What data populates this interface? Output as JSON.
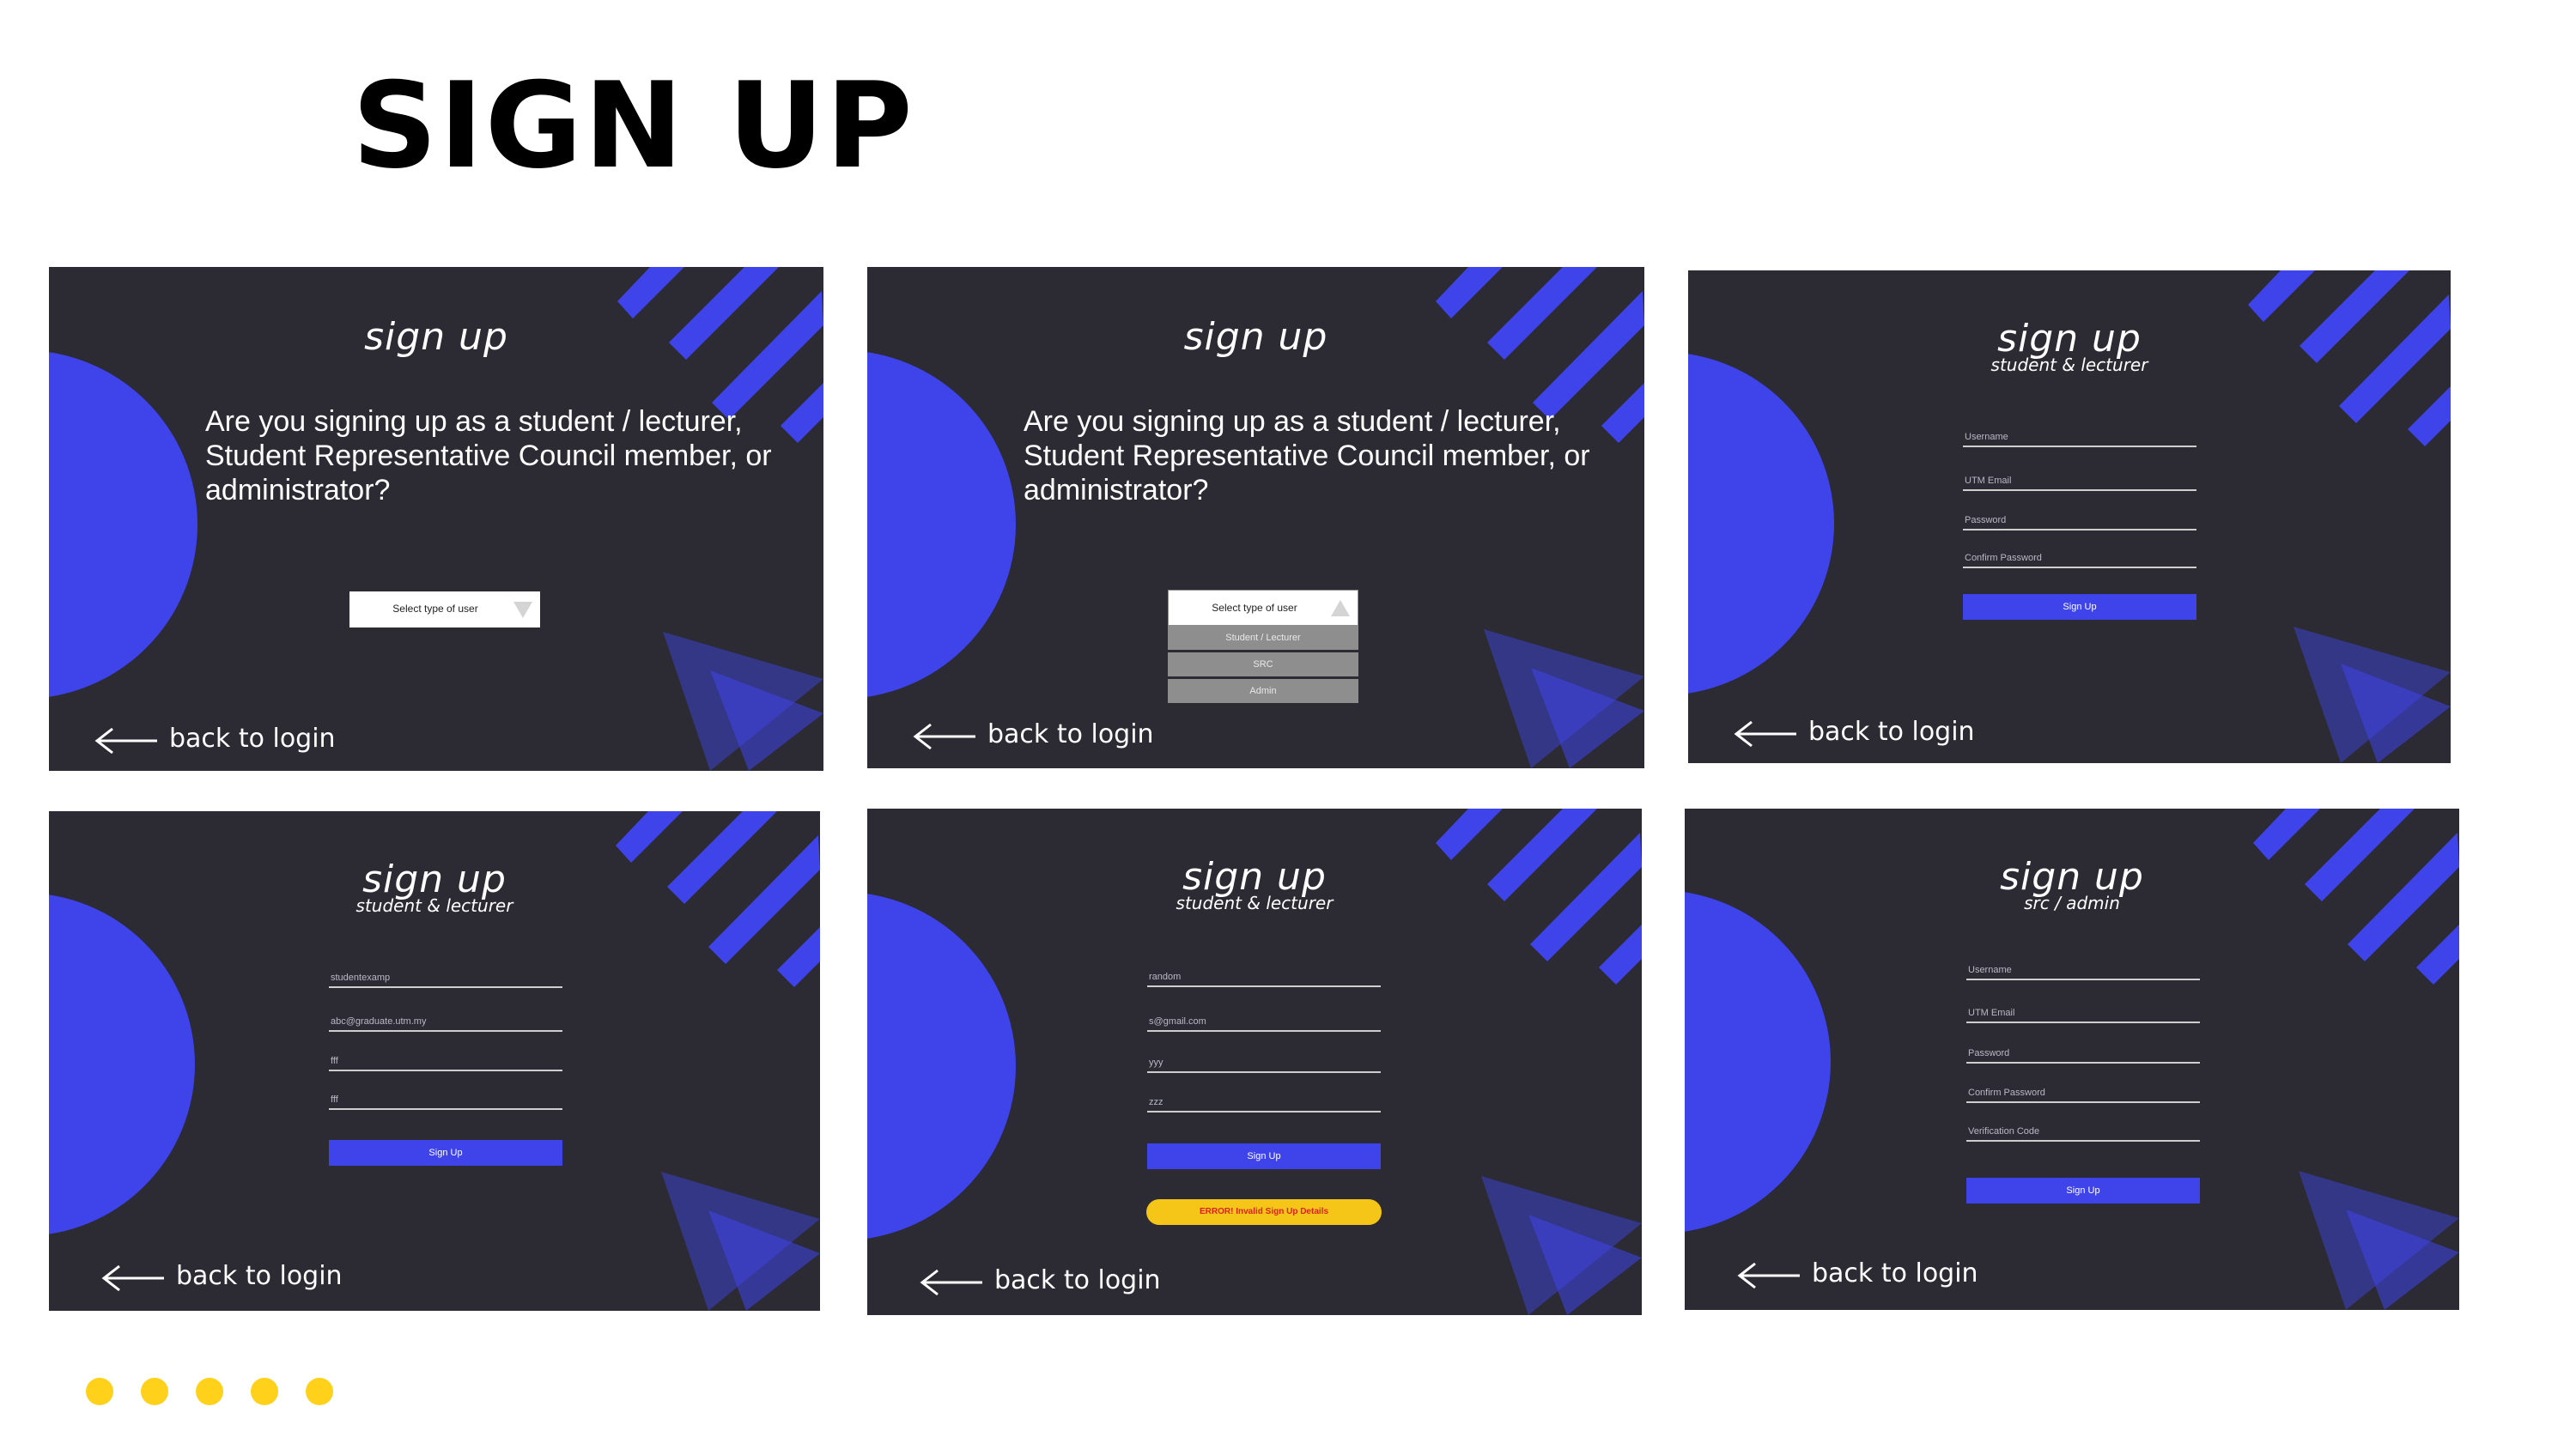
{
  "title": "SIGN UP",
  "screens": {
    "role_select_closed": {
      "logo": "sign up",
      "question": "Are you signing up as a student / lecturer, Student Representative Council member, or administrator?",
      "select_placeholder": "Select type of user",
      "back_link": "back to login"
    },
    "role_select_open": {
      "logo": "sign up",
      "question": "Are you signing up as a student / lecturer, Student Representative Council member, or administrator?",
      "select_placeholder": "Select type of user",
      "options": [
        "Student / Lecturer",
        "SRC",
        "Admin"
      ],
      "back_link": "back to login"
    },
    "student_empty": {
      "logo": "sign up",
      "subtitle": "student & lecturer",
      "fields": [
        "Username",
        "UTM Email",
        "Password",
        "Confirm Password"
      ],
      "button": "Sign Up",
      "back_link": "back to login"
    },
    "student_filled": {
      "logo": "sign up",
      "subtitle": "student & lecturer",
      "fields": [
        "studentexamp",
        "abc@graduate.utm.my",
        "fff",
        "fff"
      ],
      "button": "Sign Up",
      "back_link": "back to login"
    },
    "student_error": {
      "logo": "sign up",
      "subtitle": "student & lecturer",
      "fields": [
        "random",
        "s@gmail.com",
        "yyy",
        "zzz"
      ],
      "button": "Sign Up",
      "error": "ERROR! Invalid Sign Up Details",
      "back_link": "back to login"
    },
    "src_admin": {
      "logo": "sign up",
      "subtitle": "src / admin",
      "fields": [
        "Username",
        "UTM Email",
        "Password",
        "Confirm Password",
        "Verification Code"
      ],
      "button": "Sign Up",
      "back_link": "back to login"
    }
  },
  "colors": {
    "background": "#2c2a33",
    "accent_blue": "#3f44ea",
    "dot_yellow": "#ffd11b",
    "error_bg": "#f5c518",
    "error_text": "#e0201c"
  },
  "pagination_dots": 5
}
